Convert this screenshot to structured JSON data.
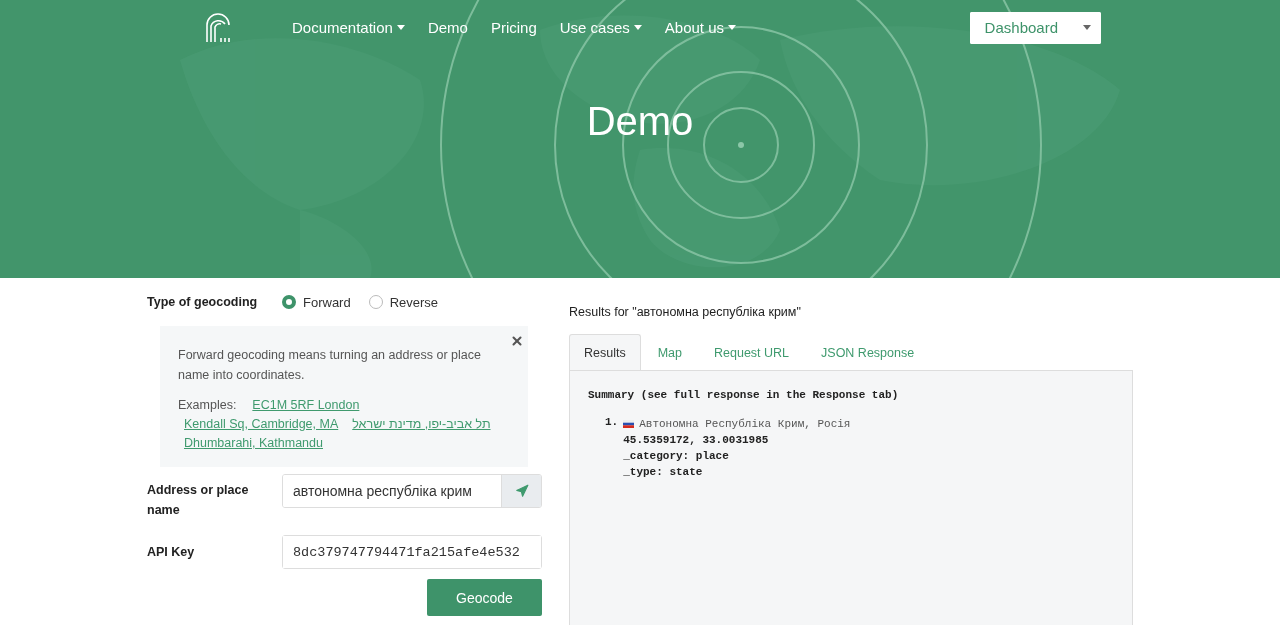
{
  "nav": {
    "items": [
      {
        "label": "Documentation",
        "has_caret": true
      },
      {
        "label": "Demo",
        "has_caret": false
      },
      {
        "label": "Pricing",
        "has_caret": false
      },
      {
        "label": "Use cases",
        "has_caret": true
      },
      {
        "label": "About us",
        "has_caret": true
      }
    ],
    "dashboard": "Dashboard"
  },
  "hero": {
    "title": "Demo"
  },
  "form": {
    "type_label": "Type of geocoding",
    "radios": [
      {
        "label": "Forward",
        "selected": true
      },
      {
        "label": "Reverse",
        "selected": false
      }
    ],
    "info": {
      "text": "Forward geocoding means turning an address or place name into coordinates.",
      "examples_label": "Examples:",
      "examples": [
        {
          "label": "EC1M 5RF London"
        },
        {
          "label": "Kendall Sq, Cambridge, MA"
        },
        {
          "label": "תל אביב-יפו, מדינת ישראל"
        },
        {
          "label": "Dhumbarahi, Kathmandu"
        }
      ]
    },
    "address_label": "Address or place name",
    "address_value": "автономна республіка крим",
    "api_label": "API Key",
    "api_value": "8dc379747794471fa215afe4e532",
    "submit": "Geocode"
  },
  "results": {
    "heading": "Results for \"автономна республіка крим\"",
    "tabs": [
      {
        "label": "Results",
        "selected": true
      },
      {
        "label": "Map",
        "selected": false
      },
      {
        "label": "Request URL",
        "selected": false
      },
      {
        "label": "JSON Response",
        "selected": false
      }
    ],
    "summary": "Summary (see full response in the Response tab)",
    "items": [
      {
        "number": "1.",
        "name": "Автономна Республіка Крим, Росія",
        "details": [
          "45.5359172, 33.0031985",
          "_category: place",
          "_type: state"
        ]
      }
    ]
  }
}
